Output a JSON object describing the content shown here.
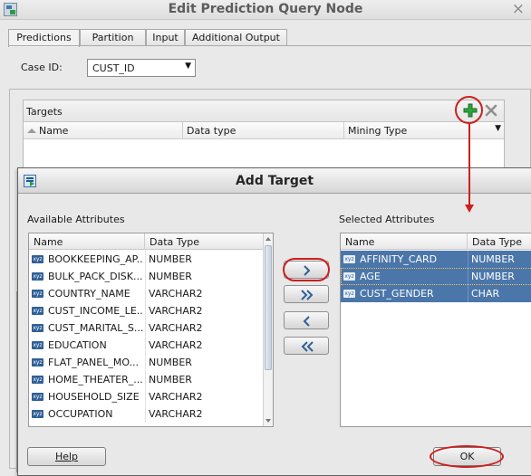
{
  "parent": {
    "title": "Edit Prediction Query Node",
    "close_glyph": "×",
    "tabs": [
      "Predictions",
      "Partition",
      "Input",
      "Additional Output"
    ],
    "case_id_label": "Case ID:",
    "case_id_value": "CUST_ID",
    "targets_title": "Targets",
    "targets_columns": [
      "Name",
      "Data type",
      "Mining Type"
    ]
  },
  "dialog": {
    "title": "Add Target",
    "available_label": "Available Attributes",
    "selected_label": "Selected Attributes",
    "columns": {
      "name": "Name",
      "type": "Data Type"
    },
    "available": [
      {
        "name": "BOOKKEEPING_AP...",
        "type": "NUMBER",
        "icon": "xyz"
      },
      {
        "name": "BULK_PACK_DISK...",
        "type": "NUMBER",
        "icon": "xyz"
      },
      {
        "name": "COUNTRY_NAME",
        "type": "VARCHAR2",
        "icon": "xyz"
      },
      {
        "name": "CUST_INCOME_LE...",
        "type": "VARCHAR2",
        "icon": "xyz"
      },
      {
        "name": "CUST_MARITAL_S...",
        "type": "VARCHAR2",
        "icon": "xyz"
      },
      {
        "name": "EDUCATION",
        "type": "VARCHAR2",
        "icon": "xyz"
      },
      {
        "name": "FLAT_PANEL_MO...",
        "type": "NUMBER",
        "icon": "xyz"
      },
      {
        "name": "HOME_THEATER_...",
        "type": "NUMBER",
        "icon": "xyz"
      },
      {
        "name": "HOUSEHOLD_SIZE",
        "type": "VARCHAR2",
        "icon": "xyz"
      },
      {
        "name": "OCCUPATION",
        "type": "VARCHAR2",
        "icon": "xyz"
      }
    ],
    "selected": [
      {
        "name": "AFFINITY_CARD",
        "type": "NUMBER",
        "icon": "xyz"
      },
      {
        "name": "AGE",
        "type": "NUMBER",
        "icon": "xyz"
      },
      {
        "name": "CUST_GENDER",
        "type": "CHAR",
        "icon": "xyz"
      }
    ],
    "help_label": "Help",
    "ok_label": "OK"
  },
  "icons": {
    "add_target": "plus-icon",
    "remove_target": "x-icon",
    "move_one": "chevron-right-icon",
    "move_all": "double-chevron-right-icon",
    "remove_one": "chevron-left-icon",
    "remove_all": "double-chevron-left-icon"
  },
  "colors": {
    "selection": "#4b76a9",
    "annotation": "#cc1f1f",
    "add_icon": "#2fa33f"
  }
}
